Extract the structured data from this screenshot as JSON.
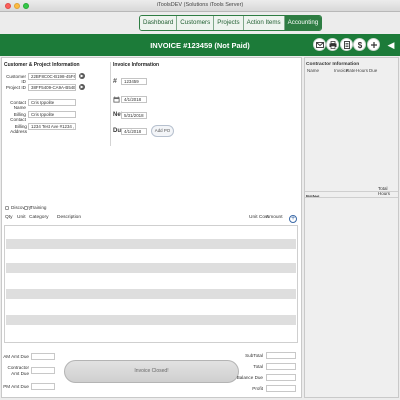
{
  "window": {
    "title": "iToolsDEV (Solutions iTools Server)"
  },
  "nav": {
    "tabs": [
      "Dashboard",
      "Customers",
      "Projects",
      "Action Items",
      "Accounting"
    ],
    "active": "Accounting"
  },
  "header": {
    "invoice_title": "INVOICE #123459 (Not Paid)"
  },
  "toolbar_icons": [
    "email-icon",
    "print-icon",
    "document-icon",
    "dollar-icon",
    "add-icon",
    "collapse-arrow-icon"
  ],
  "customer": {
    "section_title": "Customer & Project Information",
    "customer_id_label": "Customer ID",
    "customer_id": "22BF8C0C-B198-45F6-",
    "project_id_label": "Project ID",
    "project_id": "38FF5409-CA9A-B54E-B6F9",
    "contact_name_label": "Contact Name",
    "contact_name": "Cris Ippolite",
    "billing_contact_label": "Billing Contact",
    "billing_contact": "Cris Ippolite",
    "billing_address_label": "Billing Address",
    "billing_address": "1234 Test Ave #1234 , Los"
  },
  "invoice": {
    "section_title": "Invoice Information",
    "number_symbol": "#",
    "number": "123459",
    "date": "4/1/2018",
    "net_label": "Net",
    "net_date": "5/31/2018",
    "due_label": "Due",
    "due_date": "4/1/2018",
    "add_po": "Add PO"
  },
  "checkboxes": {
    "discovery": "Discovery",
    "training": "Training"
  },
  "line_headers": {
    "qty": "Qty",
    "unit": "Unit",
    "category": "Category",
    "description": "Description",
    "unit_cost": "Unit Cost",
    "amount": "Amount"
  },
  "totals": {
    "am_amt_due": "AM Amt Due",
    "contractor_amt_due_1": "Contractor",
    "contractor_amt_due_2": "Amt Due",
    "pm_amt_due": "PM Amt Due",
    "invoice_closed": "Invoice Closed!",
    "subtotal": "SubTotal",
    "total": "Total",
    "balance_due": "Balance Due",
    "profit": "Profit"
  },
  "contractor": {
    "title": "Contractor Information",
    "cols": [
      "Name",
      "Invoice",
      "Rate",
      "Hours",
      "Due"
    ],
    "total_hours": "Total Hours",
    "notes_title": "Notes"
  },
  "colors": {
    "green": "#1c7b39",
    "tab_active": "#2e7d43"
  }
}
